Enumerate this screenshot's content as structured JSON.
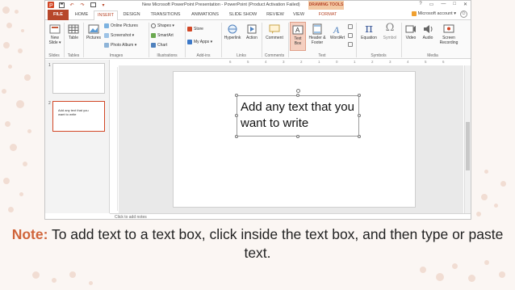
{
  "titlebar": {
    "doc_title": "New Microsoft PowerPoint Presentation - PowerPoint (Product Activation Failed)",
    "contextual_tab_group": "DRAWING TOOLS",
    "help": "?",
    "ribbon_display": "▭",
    "minimize": "—",
    "maximize": "□",
    "close": "✕"
  },
  "tabs": {
    "file": "FILE",
    "home": "HOME",
    "insert": "INSERT",
    "design": "DESIGN",
    "transitions": "TRANSITIONS",
    "animations": "ANIMATIONS",
    "slideshow": "SLIDE SHOW",
    "review": "REVIEW",
    "view": "VIEW",
    "format": "FORMAT"
  },
  "account": "Microsoft account ▾",
  "ribbon": {
    "new_slide": "New Slide ▾",
    "table": "Table",
    "pictures": "Pictures",
    "online_pictures": "Online Pictures",
    "screenshot": "Screenshot ▾",
    "photo_album": "Photo Album ▾",
    "shapes": "Shapes ▾",
    "smartart": "SmartArt",
    "chart": "Chart",
    "store": "Store",
    "my_apps": "My Apps ▾",
    "hyperlink": "Hyperlink",
    "action": "Action",
    "comment": "Comment",
    "text_box": "Text Box",
    "header_footer": "Header & Footer",
    "wordart": "WordArt",
    "equation": "Equation",
    "symbol": "Symbol",
    "video": "Video",
    "audio": "Audio",
    "screen_recording": "Screen Recording",
    "groups": {
      "slides": "Slides",
      "tables": "Tables",
      "images": "Images",
      "illustrations": "Illustrations",
      "addins": "Add-ins",
      "links": "Links",
      "comments": "Comments",
      "text": "Text",
      "symbols": "Symbols",
      "media": "Media"
    }
  },
  "ruler": [
    "6",
    "5",
    "4",
    "3",
    "2",
    "1",
    "0",
    "1",
    "2",
    "3",
    "4",
    "5",
    "6"
  ],
  "slides": [
    {
      "number": "1",
      "text": ""
    },
    {
      "number": "2",
      "text": "Add any text that you want to write"
    }
  ],
  "textbox": {
    "content": "Add any text that you want to write"
  },
  "notes_placeholder": "Click to add notes",
  "caption": {
    "label": "Note:",
    "text": " To add text to a text box, click inside the text box, and then type or paste text."
  },
  "colors": {
    "accent": "#b7472a",
    "caption_label": "#d0643a",
    "background": "#fbf6f3"
  }
}
